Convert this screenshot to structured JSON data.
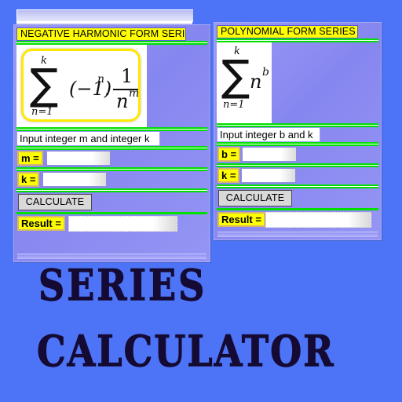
{
  "app": {
    "title_line1": "SERIES",
    "title_line2": "CALCULATOR",
    "background_color": "#4d74f7",
    "title_color": "#150a33",
    "panel_color": "#8d8df2",
    "accent_yellow": "#ffff00",
    "accent_green": "#00e000"
  },
  "panels": [
    {
      "id": "negative-harmonic",
      "header": "NEGATIVE HARMONIC FORM SERIES",
      "formula": {
        "sigma": "∑",
        "upper_limit": "k",
        "lower_limit": "n=1",
        "expression": "(−1)ⁿ . 1/nᵐ",
        "term_base": "(−1)",
        "term_exp": "n",
        "dot": ".",
        "fraction_numerator": "1",
        "fraction_denominator_base": "n",
        "fraction_denominator_exp": "m"
      },
      "instruction": "Input integer m and integer k",
      "fields": [
        {
          "label": "m =",
          "value": "",
          "placeholder": ""
        },
        {
          "label": "k =",
          "value": "",
          "placeholder": ""
        }
      ],
      "button": "CALCULATE",
      "result_label": "Result =",
      "result_value": ""
    },
    {
      "id": "polynomial",
      "header": "POLYNOMIAL FORM SERIES",
      "formula": {
        "sigma": "∑",
        "upper_limit": "k",
        "lower_limit": "n=1",
        "expression": "nᵇ",
        "term_base": "n",
        "term_exp": "b"
      },
      "instruction": "Input integer b and k",
      "fields": [
        {
          "label": "b =",
          "value": "",
          "placeholder": ""
        },
        {
          "label": "k =",
          "value": "",
          "placeholder": ""
        }
      ],
      "button": "CALCULATE",
      "result_label": "Result =",
      "result_value": ""
    }
  ]
}
